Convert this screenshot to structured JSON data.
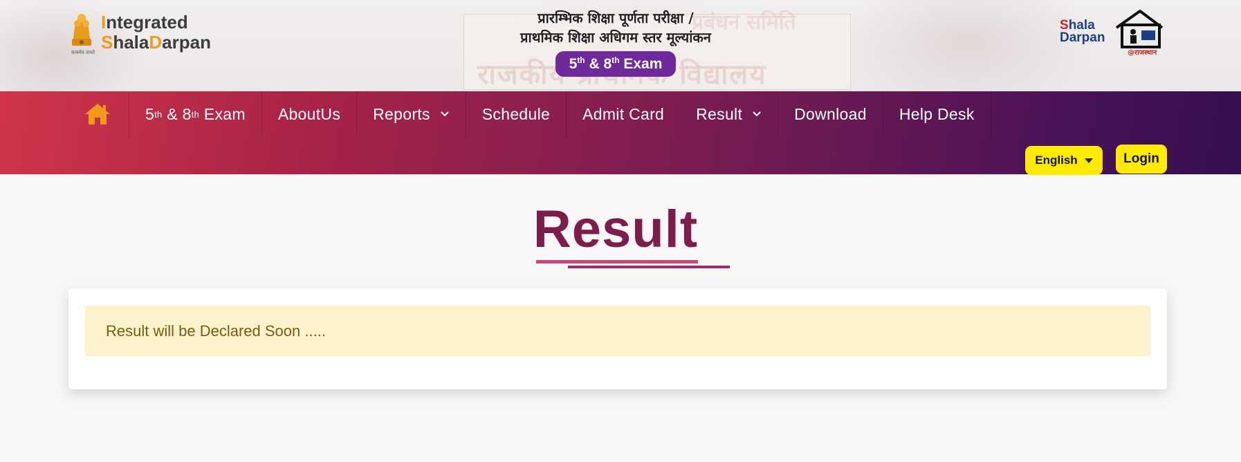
{
  "header": {
    "logo_left": {
      "line1_first": "I",
      "line1_rest": "ntegrated",
      "line2_first": "S",
      "line2_mid": "hala",
      "line2_d": "D",
      "line2_rest": "arpan",
      "emblem_caption": "सत्यमेव जयते"
    },
    "title_hindi_1": "प्रारम्भिक शिक्षा पूर्णता परीक्षा /",
    "title_hindi_2": "प्राथमिक शिक्षा अधिगम स्तर मूल्यांकन",
    "exam_badge": {
      "n1": "5",
      "s1": "th",
      "mid": " & ",
      "n2": "8",
      "s2": "th",
      "tail": " Exam"
    },
    "logo_right": {
      "shala_s": "S",
      "shala_rest": "hala",
      "darpan": "Darpan",
      "sub": "@राजस्थान"
    },
    "banner_faint_1": "राजकीय प्राथमिक विद्यालय",
    "banner_faint_2": "प्रबंधन समिति"
  },
  "nav": {
    "items": [
      {
        "label": "5",
        "sup1": "th",
        "mid": " & 8",
        "sup2": "th",
        "tail": " Exam"
      },
      {
        "label": "AboutUs"
      },
      {
        "label": "Reports"
      },
      {
        "label": "Schedule"
      },
      {
        "label": "Admit Card"
      },
      {
        "label": "Result"
      },
      {
        "label": "Download"
      },
      {
        "label": "Help Desk"
      }
    ],
    "language": "English",
    "login": "Login"
  },
  "main": {
    "title": "Result",
    "alert": "Result will be Declared Soon ....."
  },
  "colors": {
    "nav_start": "#d0354a",
    "nav_end": "#34104f",
    "title": "#7c1d4c",
    "accent_yellow": "#ffeb00",
    "alert_bg": "#fff3cd",
    "home_icon": "#f29a1b",
    "badge": "#6e2a9b"
  },
  "icons": {
    "home": "home-icon",
    "chevron": "chevron-down-icon",
    "caret": "caret-down-icon"
  }
}
